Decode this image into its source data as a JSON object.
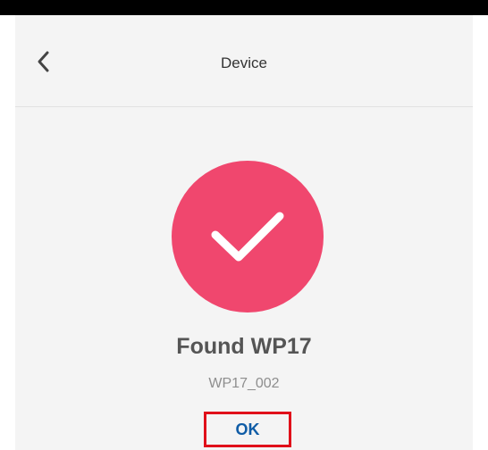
{
  "header": {
    "back_icon": "chevron-left-icon",
    "title": "Device"
  },
  "result": {
    "status_icon": "checkmark-icon",
    "status_color": "#f0476e",
    "title": "Found WP17",
    "device_id": "WP17_002"
  },
  "actions": {
    "ok_label": "OK",
    "ok_color": "#0f5ca6",
    "highlight_color": "#e0101a"
  }
}
